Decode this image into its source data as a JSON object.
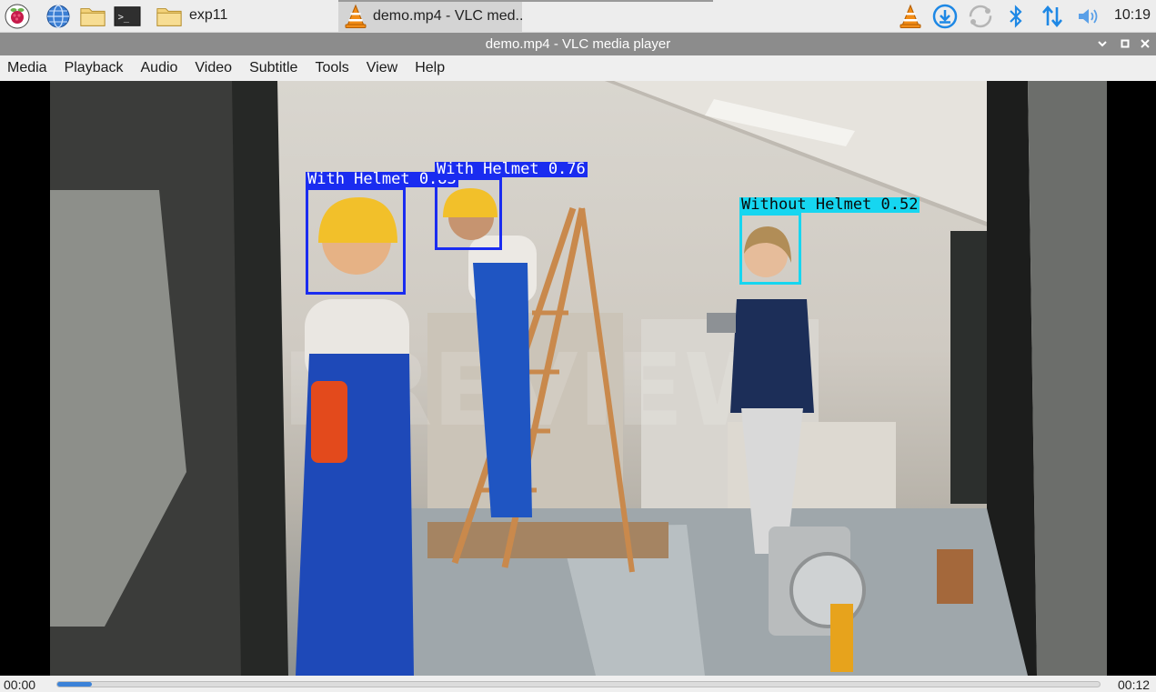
{
  "taskbar": {
    "folder_label": "exp11",
    "task_label": "demo.mp4 - VLC med..",
    "clock": "10:19"
  },
  "window": {
    "title": "demo.mp4 - VLC media player"
  },
  "menu": [
    "Media",
    "Playback",
    "Audio",
    "Video",
    "Subtitle",
    "Tools",
    "View",
    "Help"
  ],
  "video": {
    "watermark": "PREVIEW",
    "detections": [
      {
        "label": "With Helmet 0.83",
        "color": "#1a2cf0"
      },
      {
        "label": "With Helmet 0.76",
        "color": "#1a2cf0"
      },
      {
        "label": "Without Helmet 0.52",
        "color": "#16d6f0"
      }
    ]
  },
  "playback": {
    "elapsed": "00:00",
    "total": "00:12",
    "progress_fraction": 0.033
  },
  "colors": {
    "accent": "#3b82d8",
    "vlc_orange": "#f28c16",
    "taskbar_blue": "#1e88e5"
  }
}
